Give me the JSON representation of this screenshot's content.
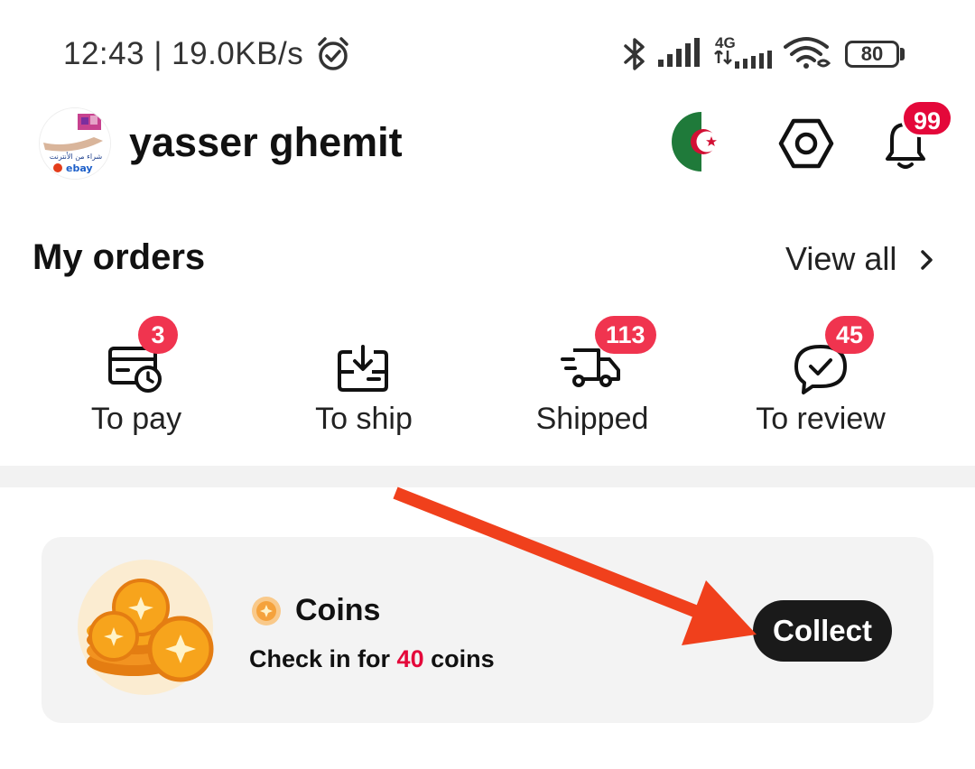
{
  "status_bar": {
    "time": "12:43",
    "separator": "|",
    "speed": "19.0KB/s",
    "network_type": "4G",
    "battery": "80",
    "icons": [
      "alarm-icon",
      "bluetooth-icon",
      "signal-icon",
      "4g-signal-icon",
      "wifi-icon",
      "battery-icon"
    ]
  },
  "profile": {
    "username": "yasser ghemit",
    "avatar_icon": "avatar",
    "flag_icon": "algeria-flag-icon",
    "settings_icon": "gear-icon",
    "notifications_icon": "bell-icon",
    "notifications_badge": "99"
  },
  "orders": {
    "title": "My orders",
    "view_all": "View all",
    "items": [
      {
        "label": "To pay",
        "badge": "3",
        "icon": "card-clock-icon"
      },
      {
        "label": "To ship",
        "badge": "",
        "icon": "box-download-icon"
      },
      {
        "label": "Shipped",
        "badge": "113",
        "icon": "truck-icon"
      },
      {
        "label": "To review",
        "badge": "45",
        "icon": "chat-check-icon"
      }
    ]
  },
  "coins": {
    "title": "Coins",
    "subtitle_prefix": "Check in for",
    "subtitle_amount": "40",
    "subtitle_suffix": "coins",
    "button": "Collect"
  },
  "colors": {
    "badge": "#f0344f",
    "bell_badge": "#e4083a",
    "button_bg": "#1a1a1a",
    "card_bg": "#f3f3f3",
    "arrow": "#f0401c",
    "coin": "#f7a41c"
  }
}
